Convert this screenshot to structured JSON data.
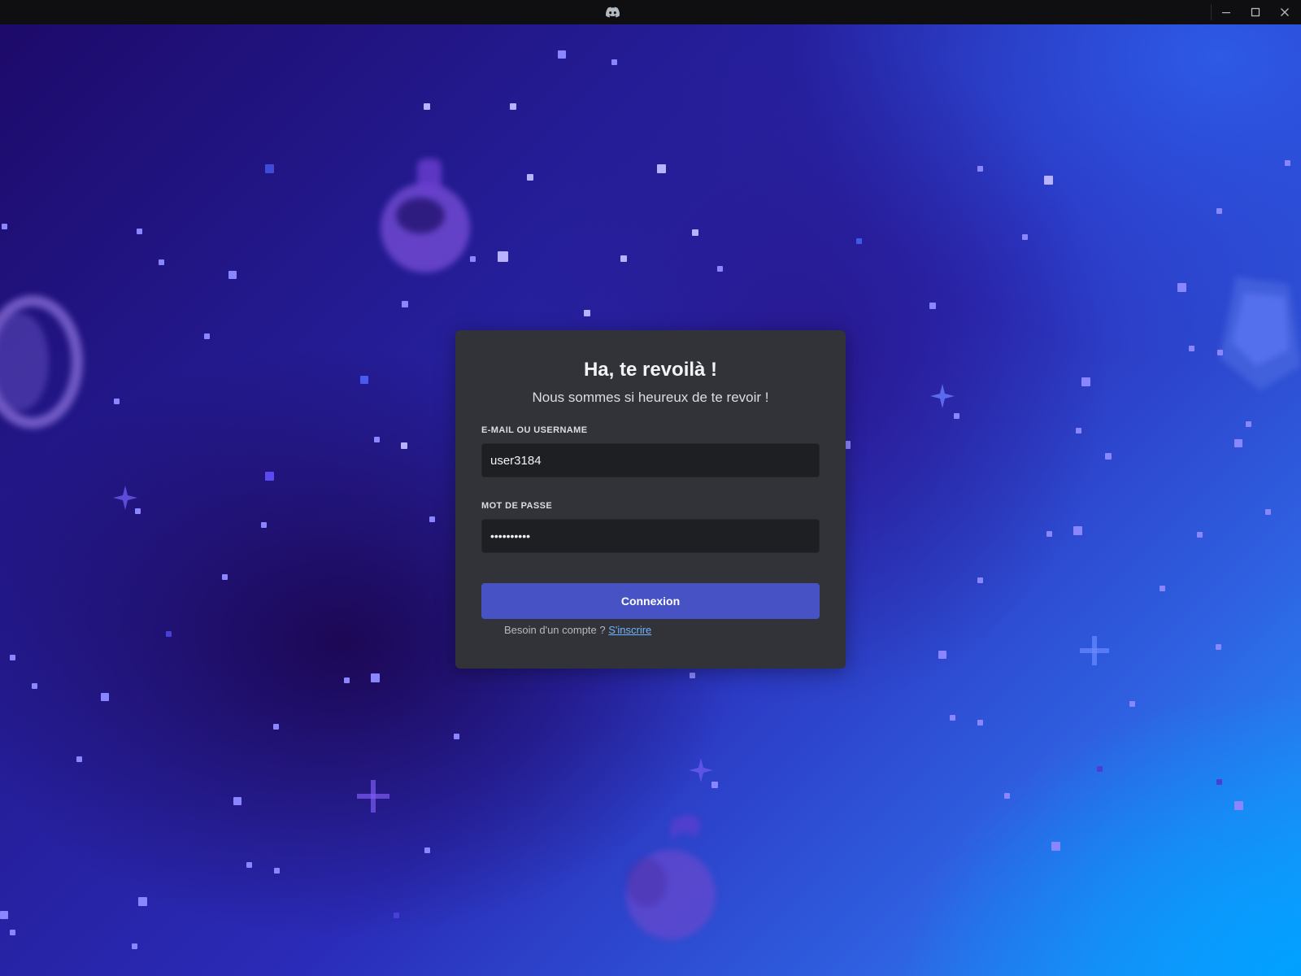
{
  "window": {
    "app_icon": "discord-icon",
    "controls": {
      "minimize_icon": "minimize-icon",
      "maximize_icon": "maximize-icon",
      "close_icon": "close-icon"
    }
  },
  "login": {
    "title": "Ha, te revoilà !",
    "subtitle": "Nous sommes si heureux de te revoir !",
    "email_label": "E-MAIL OU USERNAME",
    "email_value": "user3184",
    "password_label": "MOT DE PASSE",
    "password_value": "••••••••••",
    "submit_label": "Connexion",
    "register_prompt": "Besoin d'un compte ? ",
    "register_link": "S'inscrire"
  },
  "colors": {
    "card_bg": "#313338",
    "input_bg": "#1e1f22",
    "button_bg": "#4752c4",
    "link": "#6fb4ff",
    "titlebar_bg": "#0f0f12"
  }
}
